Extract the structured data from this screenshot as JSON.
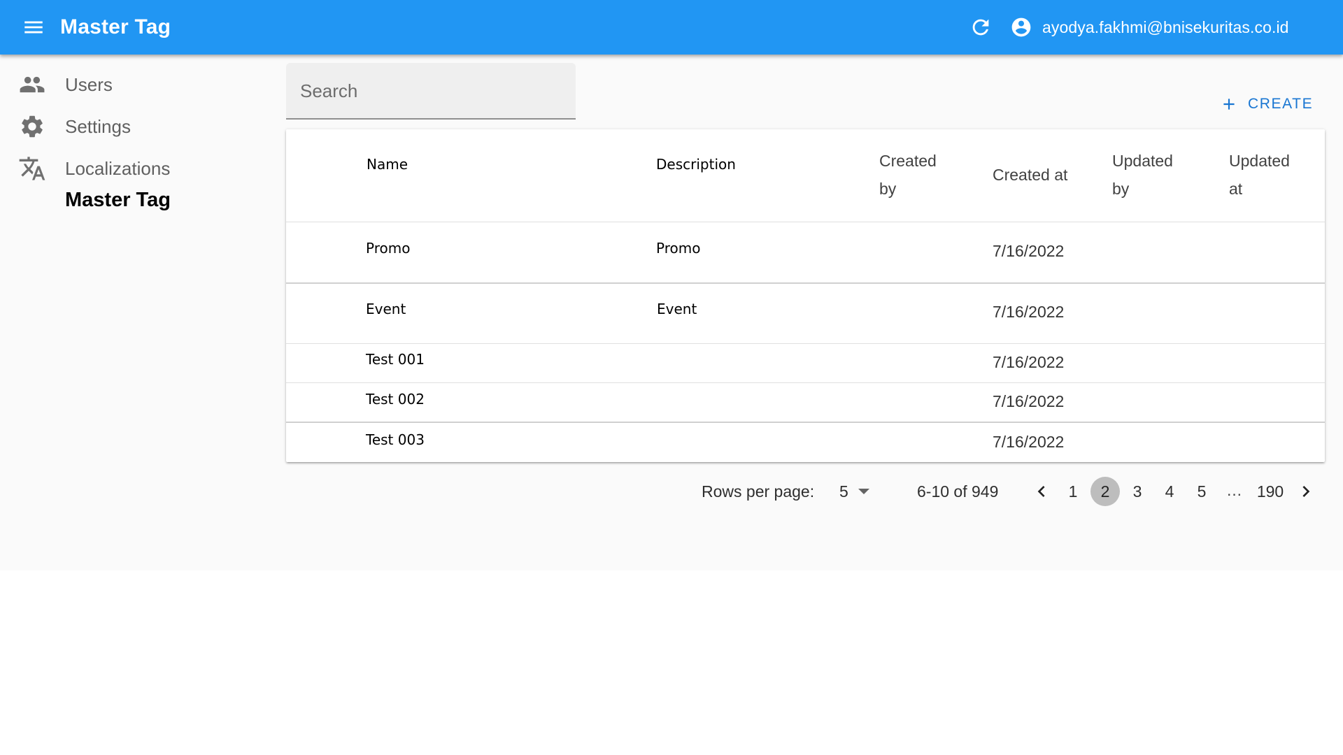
{
  "appbar": {
    "title": "Master Tag",
    "user_email": "ayodya.fakhmi@bnisekuritas.co.id",
    "icons": {
      "menu": "menu-icon",
      "refresh": "refresh-icon",
      "account": "account-circle-icon"
    },
    "color": "#2196f3"
  },
  "sidebar": {
    "items": [
      {
        "label": "Users",
        "icon": "people-icon"
      },
      {
        "label": "Settings",
        "icon": "gear-icon"
      },
      {
        "label": "Localizations",
        "icon": "translate-icon"
      }
    ],
    "sub_item": "Master Tag"
  },
  "search": {
    "placeholder": "Search",
    "value": ""
  },
  "toolbar": {
    "create_label": "CREATE",
    "accent": "#1976d2"
  },
  "table": {
    "headers": {
      "name": "Name",
      "description": "Description",
      "created_by_1": "Created",
      "created_by_2": "by",
      "created_at": "Created at",
      "updated_by_1": "Updated",
      "updated_by_2": "by",
      "updated_at_1": "Updated",
      "updated_at_2": "at"
    },
    "rows": [
      {
        "name": "Promo",
        "description": "Promo",
        "created_by": "",
        "created_at": "7/16/2022",
        "updated_by": "",
        "updated_at": ""
      },
      {
        "name": "Event",
        "description": "Event",
        "created_by": "",
        "created_at": "7/16/2022",
        "updated_by": "",
        "updated_at": ""
      },
      {
        "name": "Test 001",
        "description": "",
        "created_by": "",
        "created_at": "7/16/2022",
        "updated_by": "",
        "updated_at": ""
      },
      {
        "name": "Test 002",
        "description": "",
        "created_by": "",
        "created_at": "7/16/2022",
        "updated_by": "",
        "updated_at": ""
      },
      {
        "name": "Test 003",
        "description": "",
        "created_by": "",
        "created_at": "7/16/2022",
        "updated_by": "",
        "updated_at": ""
      }
    ]
  },
  "pagination": {
    "rows_per_page_label": "Rows per page:",
    "rows_per_page": "5",
    "range": "6-10 of 949",
    "pages": [
      "1",
      "2",
      "3",
      "4",
      "5"
    ],
    "ellipsis": "…",
    "last_page": "190",
    "current_page": "2"
  }
}
